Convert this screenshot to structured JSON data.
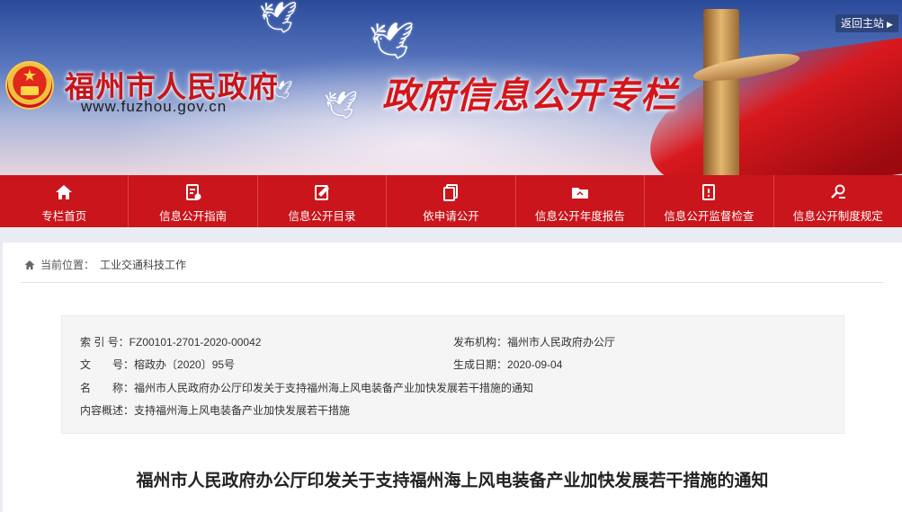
{
  "header": {
    "site_title": "福州市人民政府",
    "site_url": "www.fuzhou.gov.cn",
    "banner_title": "政府信息公开专栏",
    "back_link": "返回主站"
  },
  "nav": {
    "items": [
      {
        "label": "专栏首页",
        "icon": "home-icon"
      },
      {
        "label": "信息公开指南",
        "icon": "guide-icon"
      },
      {
        "label": "信息公开目录",
        "icon": "catalog-icon"
      },
      {
        "label": "依申请公开",
        "icon": "apply-icon"
      },
      {
        "label": "信息公开年度报告",
        "icon": "folder-icon"
      },
      {
        "label": "信息公开监督检查",
        "icon": "inspection-icon"
      },
      {
        "label": "信息公开制度规定",
        "icon": "regulation-icon"
      }
    ]
  },
  "breadcrumb": {
    "prefix": "当前位置：",
    "link": "工业交通科技工作"
  },
  "meta": {
    "index_label": "索 引 号：",
    "index_value": "FZ00101-2701-2020-00042",
    "publisher_label": "发布机构：",
    "publisher_value": "福州市人民政府办公厅",
    "docno_label": "文　　号：",
    "docno_value": "榕政办〔2020〕95号",
    "date_label": "生成日期：",
    "date_value": "2020-09-04",
    "name_label": "名　　称：",
    "name_value": "福州市人民政府办公厅印发关于支持福州海上风电装备产业加快发展若干措施的通知",
    "summary_label": "内容概述：",
    "summary_value": "支持福州海上风电装备产业加快发展若干措施"
  },
  "document": {
    "title": "福州市人民政府办公厅印发关于支持福州海上风电装备产业加快发展若干措施的通知"
  },
  "colors": {
    "nav_red": "#c9151b",
    "title_red": "#c4161c"
  }
}
